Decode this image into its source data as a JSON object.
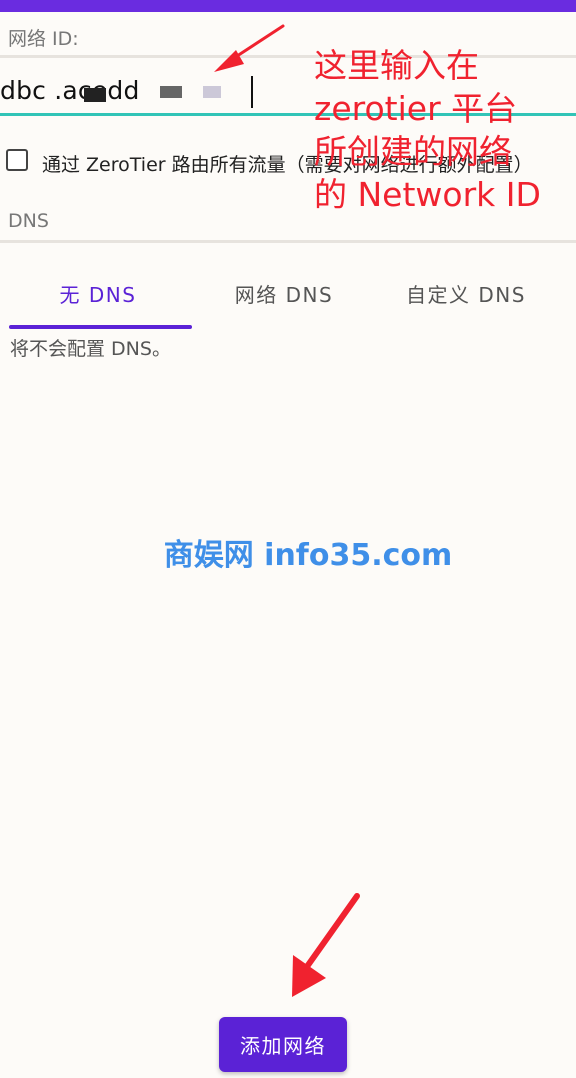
{
  "network": {
    "label": "网络 ID:",
    "value": "dbc        .acedd"
  },
  "route_all_traffic": {
    "label": "通过 ZeroTier 路由所有流量（需要对网络进行额外配置）",
    "checked": false
  },
  "dns": {
    "label": "DNS",
    "tabs": [
      {
        "label": "无 DNS",
        "selected": true
      },
      {
        "label": "网络 DNS",
        "selected": false
      },
      {
        "label": "自定义 DNS",
        "selected": false
      }
    ],
    "description": "将不会配置 DNS。"
  },
  "annotation": {
    "lines": [
      "这里输入在",
      "zerotier 平台",
      "所创建的网络",
      "的 Network ID"
    ],
    "color": "#f0222f"
  },
  "watermark": "商娱网 info35.com",
  "actions": {
    "add_network_label": "添加网络"
  },
  "colors": {
    "accent": "#5b22d6",
    "input_underline": "#31c4b7",
    "annotation": "#f0222f",
    "watermark": "#3f8fe8"
  },
  "icons": [
    "arrow-pointer-icon"
  ]
}
